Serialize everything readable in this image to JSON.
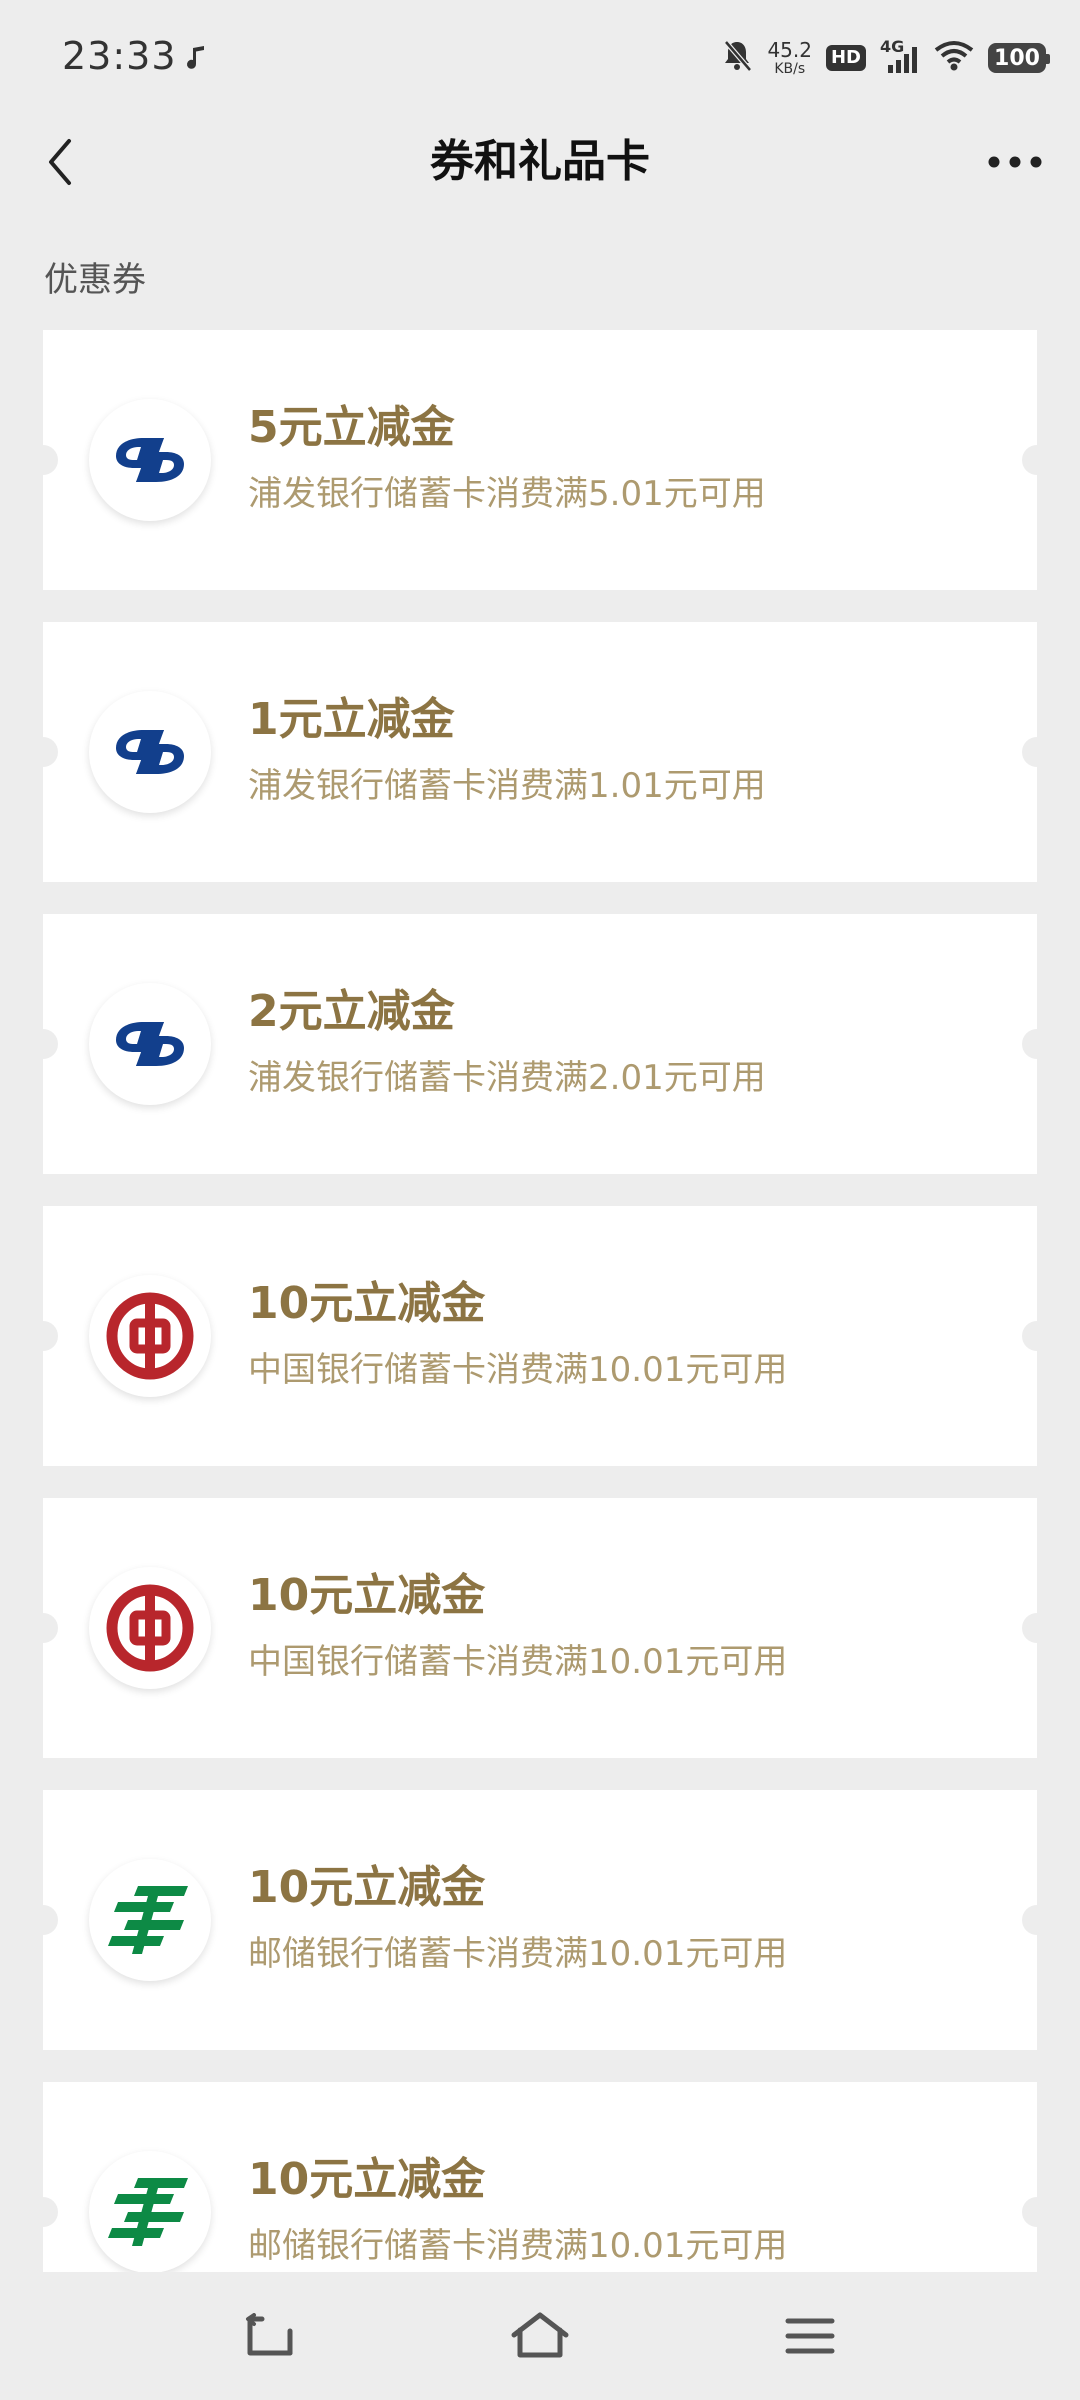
{
  "status_bar": {
    "time": "23:33",
    "net_speed_value": "45.2",
    "net_speed_unit": "KB/s",
    "hd_label": "HD",
    "network_label": "4G",
    "battery": "100"
  },
  "nav": {
    "title": "券和礼品卡"
  },
  "section": {
    "label": "优惠券"
  },
  "coupons": [
    {
      "bank": "spdb",
      "title": "5元立减金",
      "desc": "浦发银行储蓄卡消费满5.01元可用"
    },
    {
      "bank": "spdb",
      "title": "1元立减金",
      "desc": "浦发银行储蓄卡消费满1.01元可用"
    },
    {
      "bank": "spdb",
      "title": "2元立减金",
      "desc": "浦发银行储蓄卡消费满2.01元可用"
    },
    {
      "bank": "boc",
      "title": "10元立减金",
      "desc": "中国银行储蓄卡消费满10.01元可用"
    },
    {
      "bank": "boc",
      "title": "10元立减金",
      "desc": "中国银行储蓄卡消费满10.01元可用"
    },
    {
      "bank": "psbc",
      "title": "10元立减金",
      "desc": "邮储银行储蓄卡消费满10.01元可用"
    },
    {
      "bank": "psbc",
      "title": "10元立减金",
      "desc": "邮储银行储蓄卡消费满10.01元可用"
    }
  ],
  "icons": {
    "spdb": "spdb-bank-logo-icon",
    "boc": "boc-bank-logo-icon",
    "psbc": "psbc-bank-logo-icon"
  },
  "colors": {
    "coupon_title": "#8c7443",
    "coupon_desc": "#ad9a6f",
    "spdb_blue": "#123f8c",
    "boc_red": "#b8262c",
    "psbc_green": "#0d8a45",
    "background": "#ededed"
  }
}
